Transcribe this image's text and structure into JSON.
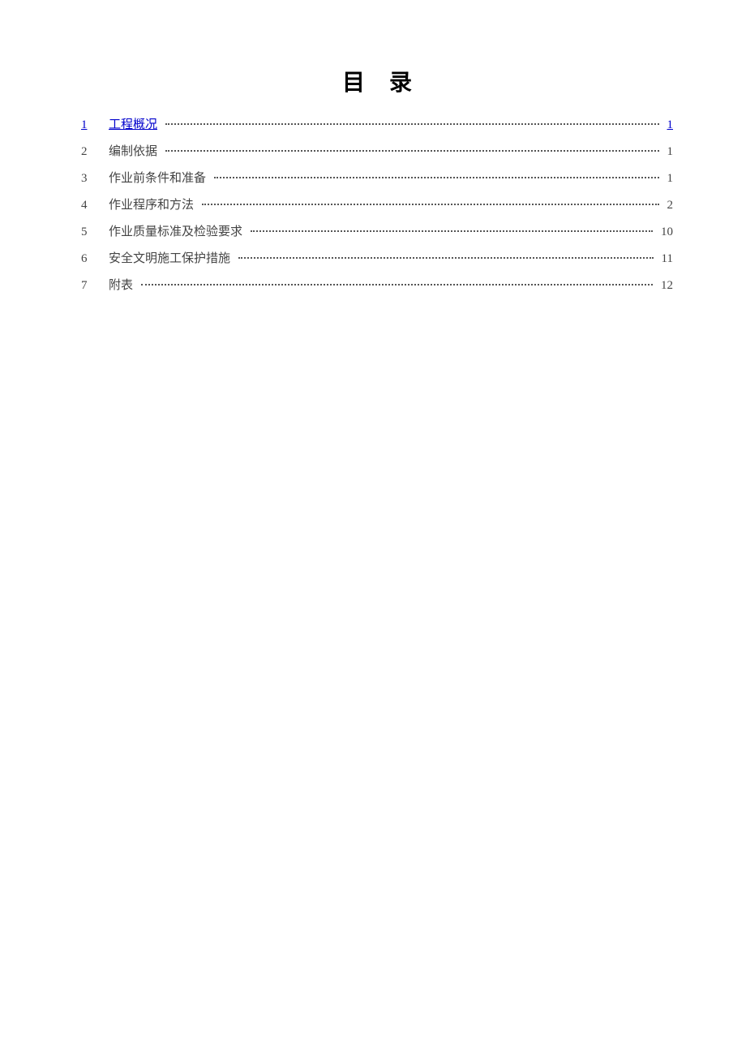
{
  "title": "目录",
  "toc": [
    {
      "num": "1",
      "label": "工程概况",
      "page": "1",
      "link": true
    },
    {
      "num": "2",
      "label": "编制依据",
      "page": "1",
      "link": false
    },
    {
      "num": "3",
      "label": "作业前条件和准备",
      "page": "1",
      "link": false
    },
    {
      "num": "4",
      "label": "作业程序和方法",
      "page": "2",
      "link": false
    },
    {
      "num": "5",
      "label": "作业质量标准及检验要求",
      "page": "10",
      "link": false
    },
    {
      "num": "6",
      "label": "安全文明施工保护措施",
      "page": "11",
      "link": false
    },
    {
      "num": "7",
      "label": "附表",
      "page": "12",
      "link": false
    }
  ]
}
